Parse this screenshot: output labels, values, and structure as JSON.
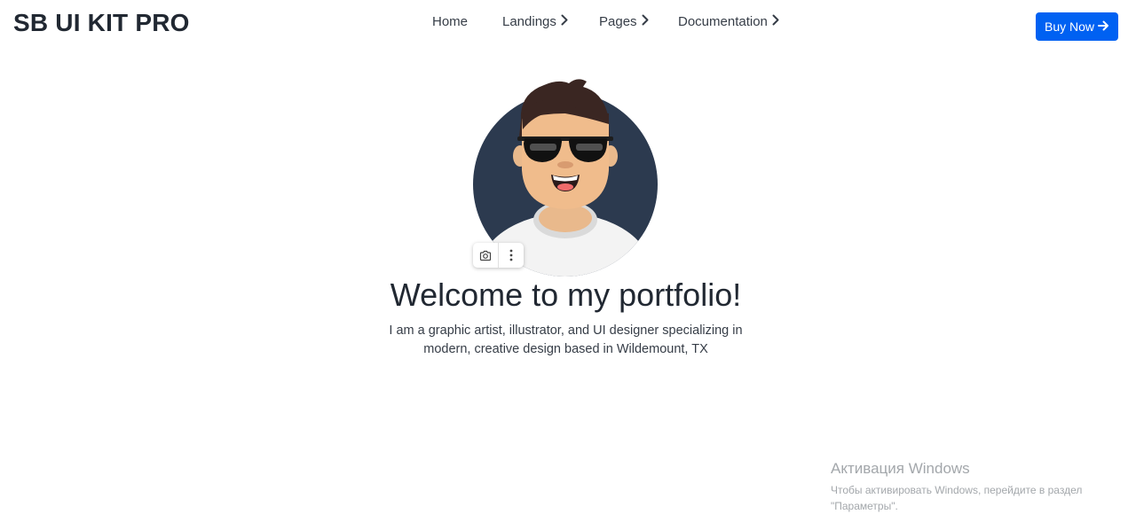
{
  "brand": "SB UI KIT PRO",
  "nav": {
    "home": "Home",
    "landings": "Landings",
    "pages": "Pages",
    "documentation": "Documentation"
  },
  "buy_button": {
    "label": "Buy Now",
    "icon": "arrow-right-icon",
    "color": "#0061f2"
  },
  "hero": {
    "title": "Welcome to my portfolio!",
    "subtitle": "I am a graphic artist, illustrator, and UI designer specializing in modern, creative design based in Wildemount, TX"
  },
  "image_toolbar": {
    "icons": [
      "camera-icon",
      "more-vertical-icon"
    ]
  },
  "windows_activation": {
    "title": "Активация Windows",
    "line1": "Чтобы активировать Windows, перейдите в раздел",
    "line2": "\"Параметры\"."
  }
}
